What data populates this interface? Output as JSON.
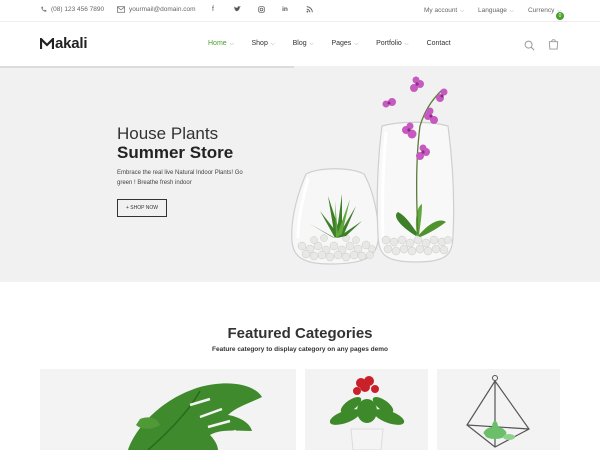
{
  "topbar": {
    "phone": "(08) 123 456 7890",
    "email": "yourmail@domain.com",
    "socials": [
      "facebook-icon",
      "twitter-icon",
      "instagram-icon",
      "linkedin-icon",
      "rss-icon"
    ],
    "account": "My account",
    "language": "Language",
    "currency": "Currency"
  },
  "header": {
    "logo": "akali",
    "nav": [
      "Home",
      "Shop",
      "Blog",
      "Pages",
      "Portfolio",
      "Contact"
    ],
    "cart_count": "0",
    "accent": "#4a9f2e"
  },
  "hero": {
    "title_line1": "House Plants",
    "title_line2": "Summer Store",
    "description": "Embrace the real live Natural Indoor Plants! Go green ! Breathe fresh indoor",
    "button": "+ SHOP NOW"
  },
  "featured": {
    "title": "Featured Categories",
    "subtitle": "Feature category to display category on any pages demo"
  }
}
